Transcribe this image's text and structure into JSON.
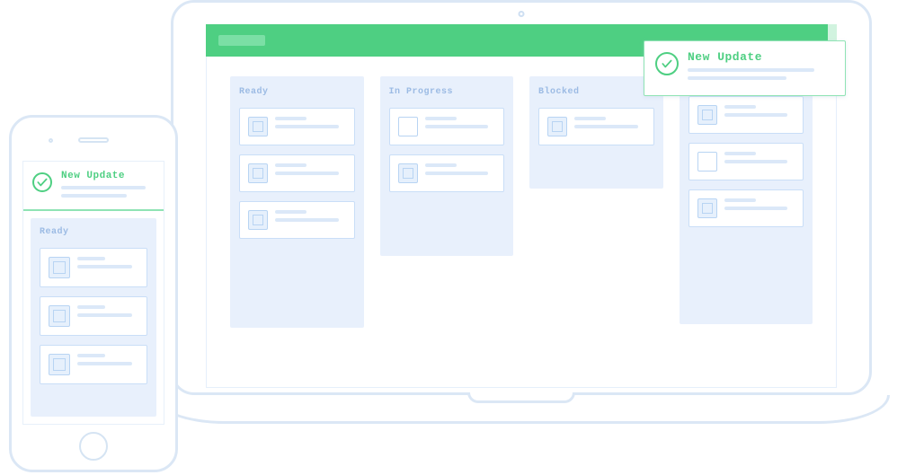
{
  "notification": {
    "title": "New Update"
  },
  "board": {
    "columns": [
      {
        "title": "Ready",
        "card_count": 3
      },
      {
        "title": "In Progress",
        "card_count": 2
      },
      {
        "title": "Blocked",
        "card_count": 1
      },
      {
        "title": "",
        "card_count": 3
      }
    ]
  },
  "phone_board": {
    "column_title": "Ready",
    "card_count": 3
  }
}
